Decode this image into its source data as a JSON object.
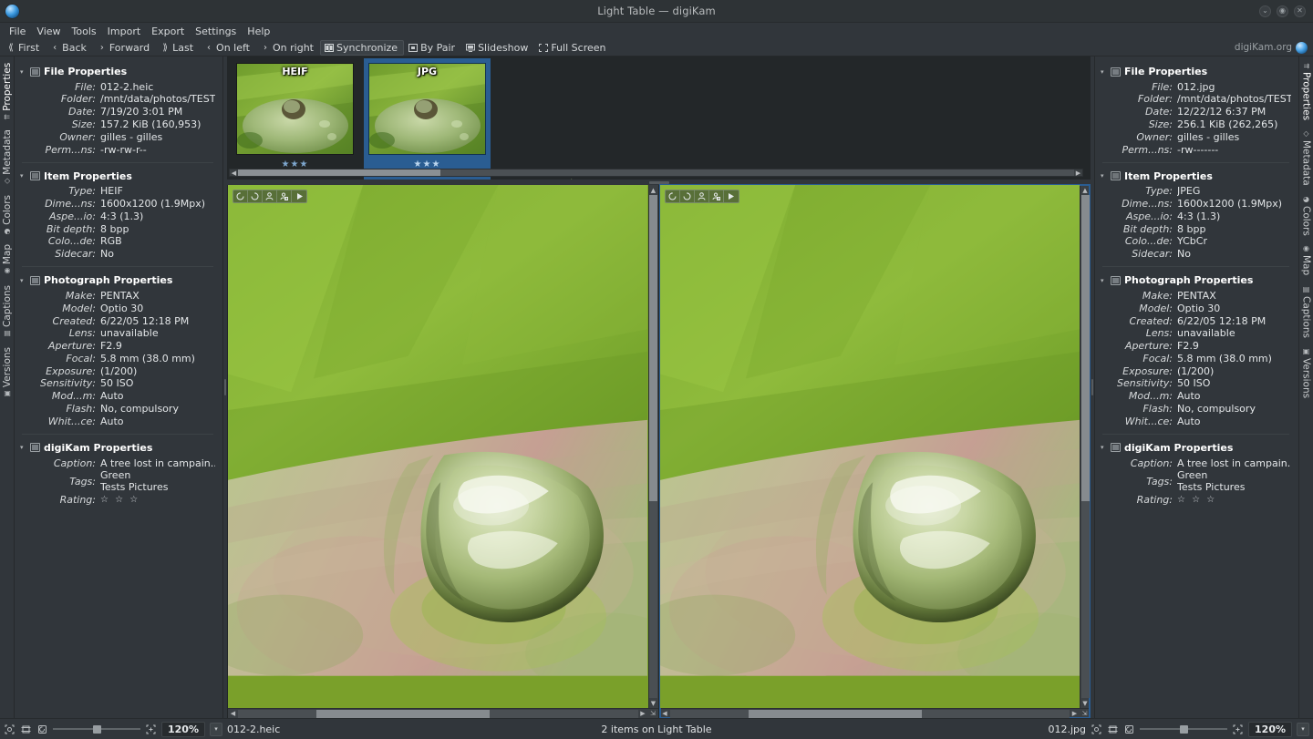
{
  "window": {
    "title": "Light Table — digiKam",
    "logo_icon": "digikam-logo-icon",
    "buttons": [
      {
        "name": "minimize-button",
        "glyph": "⌄"
      },
      {
        "name": "maximize-button",
        "glyph": "◉"
      },
      {
        "name": "close-button",
        "glyph": "✕"
      }
    ]
  },
  "menubar": {
    "items": [
      {
        "label": "File"
      },
      {
        "label": "View"
      },
      {
        "label": "Tools"
      },
      {
        "label": "Import"
      },
      {
        "label": "Export"
      },
      {
        "label": "Settings"
      },
      {
        "label": "Help"
      }
    ]
  },
  "toolbar": {
    "buttons": [
      {
        "label": "First",
        "icon": "first-icon",
        "glyph": "⟪",
        "active": false
      },
      {
        "label": "Back",
        "icon": "back-icon",
        "glyph": "‹",
        "active": false
      },
      {
        "label": "Forward",
        "icon": "forward-icon",
        "glyph": "›",
        "active": false
      },
      {
        "label": "Last",
        "icon": "last-icon",
        "glyph": "⟫",
        "active": false
      },
      {
        "label": "On left",
        "icon": "on-left-icon",
        "glyph": "‹",
        "active": false
      },
      {
        "label": "On right",
        "icon": "on-right-icon",
        "glyph": "›",
        "active": false
      },
      {
        "label": "Synchronize",
        "icon": "synchronize-icon",
        "glyph": "▥",
        "active": true
      },
      {
        "label": "By Pair",
        "icon": "by-pair-icon",
        "glyph": "▣",
        "active": false
      },
      {
        "label": "Slideshow",
        "icon": "slideshow-icon",
        "glyph": "▢",
        "active": false
      },
      {
        "label": "Full Screen",
        "icon": "fullscreen-icon",
        "glyph": "⛶",
        "active": false
      }
    ],
    "brand_label": "digiKam.org",
    "brand_icon": "digikam-globe-icon"
  },
  "left_tabs": {
    "items": [
      {
        "label": "Properties",
        "icon": "properties-icon",
        "glyph": "⇈",
        "active": true
      },
      {
        "label": "Metadata",
        "icon": "metadata-icon",
        "glyph": "◇",
        "active": false
      },
      {
        "label": "Colors",
        "icon": "colors-icon",
        "glyph": "◕",
        "active": false
      },
      {
        "label": "Map",
        "icon": "map-icon",
        "glyph": "◉",
        "active": false
      },
      {
        "label": "Captions",
        "icon": "captions-icon",
        "glyph": "▤",
        "active": false
      },
      {
        "label": "Versions",
        "icon": "versions-icon",
        "glyph": "▣",
        "active": false
      }
    ]
  },
  "right_tabs": {
    "items": [
      {
        "label": "Properties",
        "icon": "properties-icon",
        "glyph": "⇈",
        "active": true
      },
      {
        "label": "Metadata",
        "icon": "metadata-icon",
        "glyph": "◇",
        "active": false
      },
      {
        "label": "Colors",
        "icon": "colors-icon",
        "glyph": "◕",
        "active": false
      },
      {
        "label": "Map",
        "icon": "map-icon",
        "glyph": "◉",
        "active": false
      },
      {
        "label": "Captions",
        "icon": "captions-icon",
        "glyph": "▤",
        "active": false
      },
      {
        "label": "Versions",
        "icon": "versions-icon",
        "glyph": "▣",
        "active": false
      }
    ]
  },
  "left_panel": {
    "groups": [
      {
        "title": "File Properties",
        "icon": "file-properties-icon",
        "rows": [
          {
            "key": "File:",
            "value": "012-2.heic"
          },
          {
            "key": "Folder:",
            "value": "/mnt/data/photos/TESTS/S..."
          },
          {
            "key": "Date:",
            "value": "7/19/20 3:01 PM"
          },
          {
            "key": "Size:",
            "value": "157.2 KiB (160,953)"
          },
          {
            "key": "Owner:",
            "value": "gilles - gilles"
          },
          {
            "key": "Perm...ns:",
            "value": "-rw-rw-r--"
          }
        ]
      },
      {
        "title": "Item Properties",
        "icon": "item-properties-icon",
        "rows": [
          {
            "key": "Type:",
            "value": "HEIF"
          },
          {
            "key": "Dime...ns:",
            "value": "1600x1200 (1.9Mpx)"
          },
          {
            "key": "Aspe...io:",
            "value": "4:3 (1.3)"
          },
          {
            "key": "Bit depth:",
            "value": "8 bpp"
          },
          {
            "key": "Colo...de:",
            "value": "RGB"
          },
          {
            "key": "Sidecar:",
            "value": "No"
          }
        ]
      },
      {
        "title": "Photograph Properties",
        "icon": "photograph-properties-icon",
        "rows": [
          {
            "key": "Make:",
            "value": "PENTAX"
          },
          {
            "key": "Model:",
            "value": "Optio 30"
          },
          {
            "key": "Created:",
            "value": "6/22/05 12:18 PM"
          },
          {
            "key": "Lens:",
            "value": "unavailable"
          },
          {
            "key": "Aperture:",
            "value": "F2.9"
          },
          {
            "key": "Focal:",
            "value": "5.8 mm (38.0 mm)"
          },
          {
            "key": "Exposure:",
            "value": "(1/200)"
          },
          {
            "key": "Sensitivity:",
            "value": "50 ISO"
          },
          {
            "key": "Mod...m:",
            "value": "Auto"
          },
          {
            "key": "Flash:",
            "value": "No, compulsory"
          },
          {
            "key": "Whit...ce:",
            "value": "Auto"
          }
        ]
      },
      {
        "title": "digiKam Properties",
        "icon": "digikam-properties-icon",
        "rows": [
          {
            "key": "Caption:",
            "value": "A tree lost in campain..."
          },
          {
            "key": "Tags:",
            "value": "Green\nTests Pictures"
          },
          {
            "key": "Rating:",
            "value": "☆ ☆ ☆"
          }
        ]
      }
    ]
  },
  "right_panel": {
    "groups": [
      {
        "title": "File Properties",
        "icon": "file-properties-icon",
        "rows": [
          {
            "key": "File:",
            "value": "012.jpg"
          },
          {
            "key": "Folder:",
            "value": "/mnt/data/photos/TESTS/S..."
          },
          {
            "key": "Date:",
            "value": "12/22/12 6:37 PM"
          },
          {
            "key": "Size:",
            "value": "256.1 KiB (262,265)"
          },
          {
            "key": "Owner:",
            "value": "gilles - gilles"
          },
          {
            "key": "Perm...ns:",
            "value": "-rw-------"
          }
        ]
      },
      {
        "title": "Item Properties",
        "icon": "item-properties-icon",
        "rows": [
          {
            "key": "Type:",
            "value": "JPEG"
          },
          {
            "key": "Dime...ns:",
            "value": "1600x1200 (1.9Mpx)"
          },
          {
            "key": "Aspe...io:",
            "value": "4:3 (1.3)"
          },
          {
            "key": "Bit depth:",
            "value": "8 bpp"
          },
          {
            "key": "Colo...de:",
            "value": "YCbCr"
          },
          {
            "key": "Sidecar:",
            "value": "No"
          }
        ]
      },
      {
        "title": "Photograph Properties",
        "icon": "photograph-properties-icon",
        "rows": [
          {
            "key": "Make:",
            "value": "PENTAX"
          },
          {
            "key": "Model:",
            "value": "Optio 30"
          },
          {
            "key": "Created:",
            "value": "6/22/05 12:18 PM"
          },
          {
            "key": "Lens:",
            "value": "unavailable"
          },
          {
            "key": "Aperture:",
            "value": "F2.9"
          },
          {
            "key": "Focal:",
            "value": "5.8 mm (38.0 mm)"
          },
          {
            "key": "Exposure:",
            "value": "(1/200)"
          },
          {
            "key": "Sensitivity:",
            "value": "50 ISO"
          },
          {
            "key": "Mod...m:",
            "value": "Auto"
          },
          {
            "key": "Flash:",
            "value": "No, compulsory"
          },
          {
            "key": "Whit...ce:",
            "value": "Auto"
          }
        ]
      },
      {
        "title": "digiKam Properties",
        "icon": "digikam-properties-icon",
        "rows": [
          {
            "key": "Caption:",
            "value": "A tree lost in campain..."
          },
          {
            "key": "Tags:",
            "value": "Green\nTests Pictures"
          },
          {
            "key": "Rating:",
            "value": "☆ ☆ ☆"
          }
        ]
      }
    ]
  },
  "thumbnails": {
    "items": [
      {
        "badge": "HEIF",
        "rating": "★★★",
        "selected": false
      },
      {
        "badge": "JPG",
        "rating": "★★★",
        "selected": true
      }
    ],
    "next_glyph": "›"
  },
  "preview_left": {
    "tools": [
      {
        "name": "rotate-left-icon"
      },
      {
        "name": "rotate-right-icon"
      },
      {
        "name": "person-icon"
      },
      {
        "name": "person-tag-icon"
      },
      {
        "name": "play-icon"
      }
    ]
  },
  "preview_right": {
    "tools": [
      {
        "name": "rotate-left-icon"
      },
      {
        "name": "rotate-right-icon"
      },
      {
        "name": "person-icon"
      },
      {
        "name": "person-tag-icon"
      },
      {
        "name": "play-icon"
      }
    ]
  },
  "statusbar": {
    "left": {
      "file": "012-2.heic",
      "zoom": "120%",
      "fit_icon": "fit-to-window-icon",
      "crop_icon": "zoom-100-icon",
      "refresh_icon": "zoom-reset-icon",
      "zoom_in_icon": "zoom-in-icon",
      "dropdown_glyph": "▾"
    },
    "center": "2 items on Light Table",
    "right": {
      "file": "012.jpg",
      "zoom": "120%",
      "fit_icon": "fit-to-window-icon",
      "crop_icon": "zoom-100-icon",
      "refresh_icon": "zoom-reset-icon",
      "zoom_in_icon": "zoom-in-icon",
      "dropdown_glyph": "▾"
    }
  },
  "colors": {
    "selection": "#2a5d92",
    "panel_bg": "#31363b",
    "canvas_bg": "#232729"
  }
}
